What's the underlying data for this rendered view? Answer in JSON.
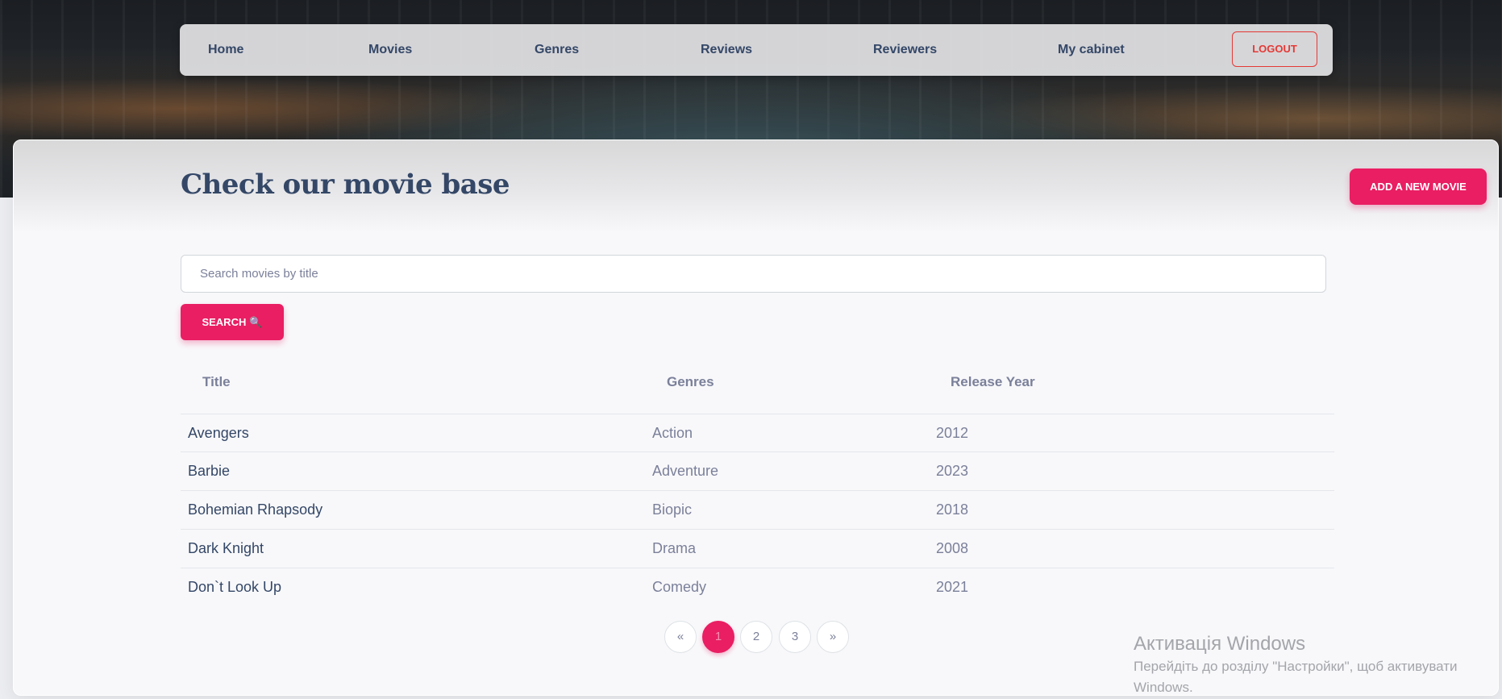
{
  "nav": {
    "items": [
      {
        "label": "Home"
      },
      {
        "label": "Movies"
      },
      {
        "label": "Genres"
      },
      {
        "label": "Reviews"
      },
      {
        "label": "Reviewers"
      },
      {
        "label": "My cabinet"
      }
    ],
    "logout_label": "Logout"
  },
  "page": {
    "title": "Check our movie base",
    "add_button": "Add a new movie"
  },
  "search": {
    "placeholder": "Search movies by title",
    "value": "",
    "button_label": "Search",
    "button_icon": "🔍"
  },
  "table": {
    "headers": [
      "Title",
      "Genres",
      "Release Year"
    ],
    "rows": [
      {
        "title": "Avengers",
        "genre": "Action",
        "year": "2012"
      },
      {
        "title": "Barbie",
        "genre": "Adventure",
        "year": "2023"
      },
      {
        "title": "Bohemian Rhapsody",
        "genre": "Biopic",
        "year": "2018"
      },
      {
        "title": "Dark Knight",
        "genre": "Drama",
        "year": "2008"
      },
      {
        "title": "Don`t Look Up",
        "genre": "Comedy",
        "year": "2021"
      }
    ]
  },
  "pagination": {
    "prev": "«",
    "pages": [
      "1",
      "2",
      "3"
    ],
    "current": "1",
    "next": "»"
  },
  "watermark": {
    "title": "Активація Windows",
    "line1": "Перейдіть до розділу \"Настройки\", щоб активувати",
    "line2": "Windows."
  },
  "colors": {
    "accent": "#e91e63",
    "heading": "#344767",
    "muted": "#7b809a",
    "logout": "#e53935"
  }
}
